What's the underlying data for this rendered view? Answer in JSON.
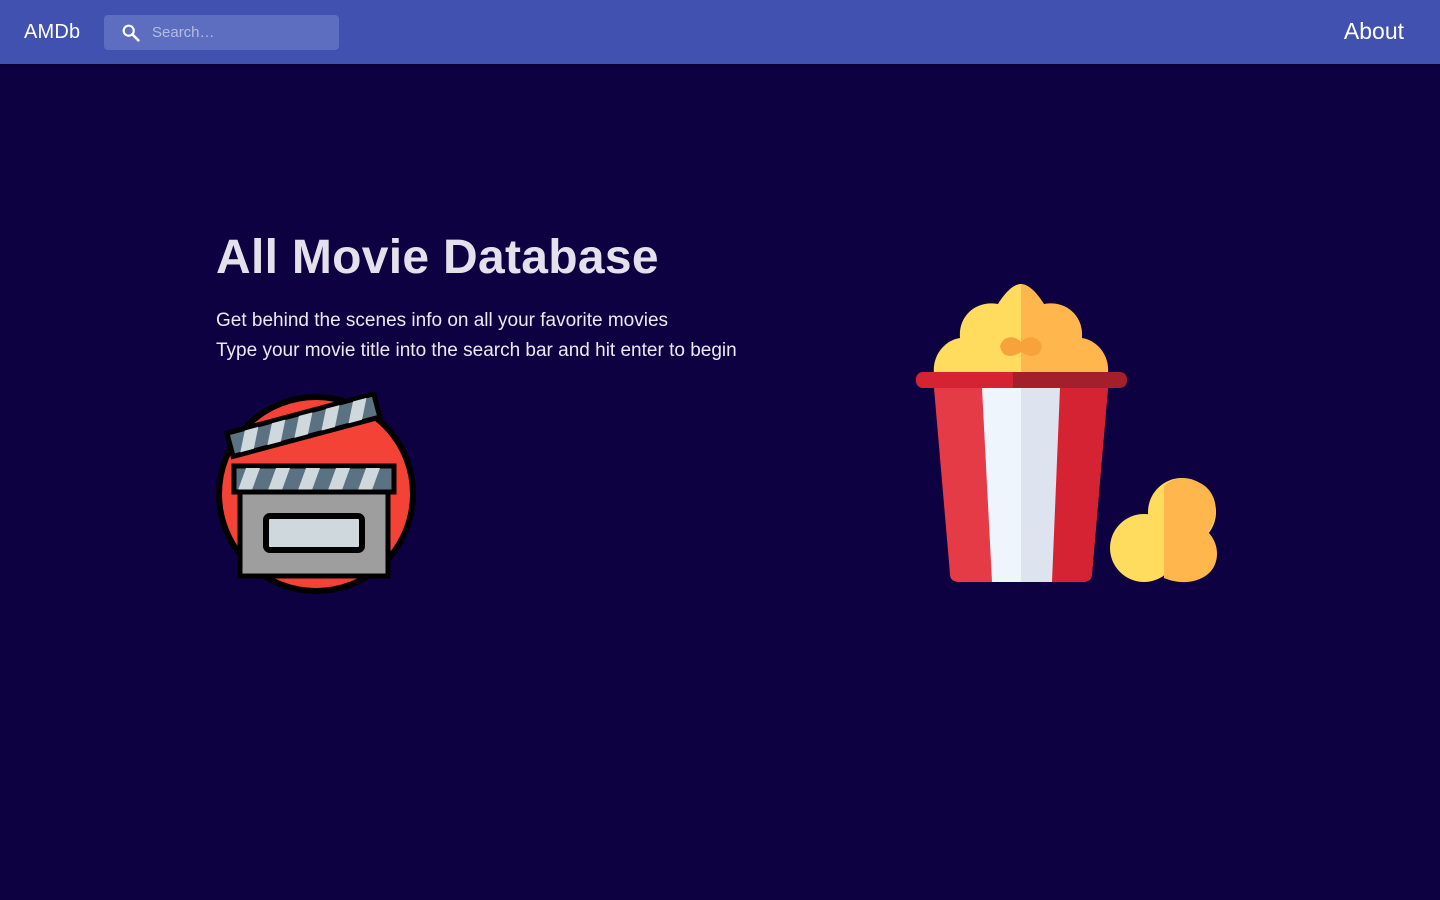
{
  "header": {
    "brand": "AMDb",
    "search_placeholder": "Search…",
    "search_value": "",
    "about_label": "About"
  },
  "hero": {
    "title": "All Movie Database",
    "lines": [
      "Get behind the scenes info on all your favorite movies",
      "Type your movie title into the search bar and hit enter to begin"
    ]
  },
  "illustrations": {
    "clapperboard": "clapperboard-icon",
    "popcorn": "popcorn-icon"
  },
  "colors": {
    "background": "#0e0142",
    "appbar": "#4051b0",
    "search_bg": "#5d6dbf"
  }
}
